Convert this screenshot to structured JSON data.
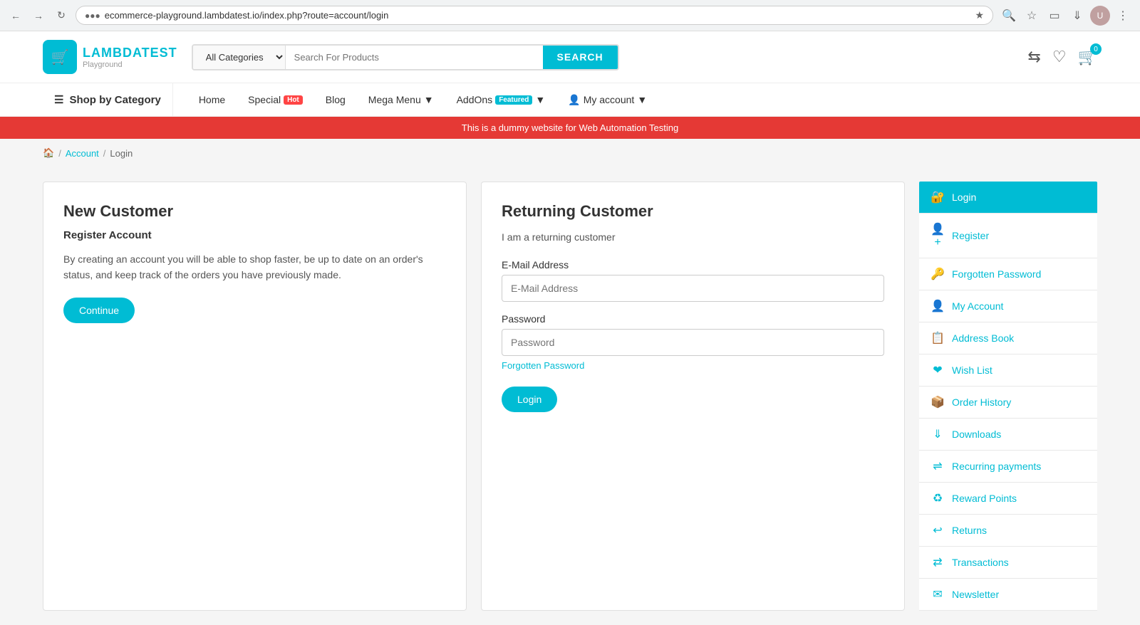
{
  "browser": {
    "url": "ecommerce-playground.lambdatest.io/index.php?route=account/login",
    "back_label": "←",
    "forward_label": "→",
    "refresh_label": "↻"
  },
  "header": {
    "logo_name": "LAMBDATEST",
    "logo_sub": "Playground",
    "search_placeholder": "Search For Products",
    "search_category": "All Categories",
    "search_button": "SEARCH",
    "cart_count": "0"
  },
  "nav": {
    "shop_by_category": "Shop by Category",
    "links": [
      {
        "label": "Home",
        "badge": null
      },
      {
        "label": "Special",
        "badge": "Hot"
      },
      {
        "label": "Blog",
        "badge": null
      },
      {
        "label": "Mega Menu",
        "badge": null,
        "has_arrow": true
      },
      {
        "label": "AddOns",
        "badge": "Featured",
        "has_arrow": true
      },
      {
        "label": "My account",
        "badge": null,
        "has_arrow": true
      }
    ]
  },
  "banner": {
    "text": "This is a dummy website for Web Automation Testing"
  },
  "breadcrumb": {
    "home_label": "🏠",
    "items": [
      "Account",
      "Login"
    ]
  },
  "new_customer": {
    "title": "New Customer",
    "subtitle": "Register Account",
    "description": "By creating an account you will be able to shop faster, be up to date on an order's status, and keep track of the orders you have previously made.",
    "button": "Continue"
  },
  "returning_customer": {
    "title": "Returning Customer",
    "subtitle": "I am a returning customer",
    "email_label": "E-Mail Address",
    "email_placeholder": "E-Mail Address",
    "password_label": "Password",
    "password_placeholder": "Password",
    "forgotten_link": "Forgotten Password",
    "login_button": "Login"
  },
  "sidebar": {
    "items": [
      {
        "id": "login",
        "label": "Login",
        "icon": "🔑",
        "active": true
      },
      {
        "id": "register",
        "label": "Register",
        "icon": "👤"
      },
      {
        "id": "forgotten-password",
        "label": "Forgotten Password",
        "icon": "🔧"
      },
      {
        "id": "my-account",
        "label": "My Account",
        "icon": "👤"
      },
      {
        "id": "address-book",
        "label": "Address Book",
        "icon": "📋"
      },
      {
        "id": "wish-list",
        "label": "Wish List",
        "icon": "❤️"
      },
      {
        "id": "order-history",
        "label": "Order History",
        "icon": "📦"
      },
      {
        "id": "downloads",
        "label": "Downloads",
        "icon": "⬇️"
      },
      {
        "id": "recurring-payments",
        "label": "Recurring payments",
        "icon": "💳"
      },
      {
        "id": "reward-points",
        "label": "Reward Points",
        "icon": "🔄"
      },
      {
        "id": "returns",
        "label": "Returns",
        "icon": "↩️"
      },
      {
        "id": "transactions",
        "label": "Transactions",
        "icon": "⇄"
      },
      {
        "id": "newsletter",
        "label": "Newsletter",
        "icon": "✉️"
      }
    ]
  }
}
